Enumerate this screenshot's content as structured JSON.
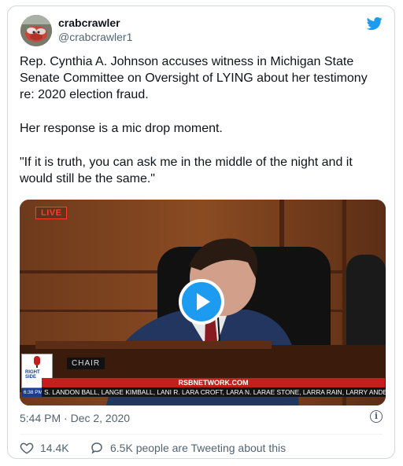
{
  "user": {
    "display_name": "crabcrawler",
    "handle": "@crabcrawler1",
    "avatar_icon": "avatar-image"
  },
  "tweet": {
    "paragraphs": [
      "Rep. Cynthia A. Johnson accuses witness in Michigan State Senate Committee on Oversight of LYING about her testimony re: 2020 election fraud.",
      "Her response is a mic drop moment.",
      "\"If it is truth, you can ask me in the middle of the night and it would still be the same.\""
    ],
    "timestamp": "5:44 PM · Dec 2, 2020"
  },
  "video": {
    "live_badge": "LIVE",
    "chair_sign": "CHAIR",
    "network_url": "RSBNETWORK.COM",
    "ticker_names": "S. LANDON BALL, LANGE KIMBALL, LANI R. LARA CROFT, LARA N. LARAE STONE, LARRA RAIN, LARRY ANDERSON, LARR",
    "logo_text_1": "RIGHT",
    "logo_text_2": "SIDE",
    "time_label": "6:38 PM ET",
    "play_icon": "play-icon"
  },
  "engagement": {
    "likes": "14.4K",
    "tweeting_text": "6.5K people are Tweeting about this"
  },
  "colors": {
    "brand_blue": "#1d9bf0",
    "muted_text": "#536471",
    "live_red": "#ff3b30",
    "ticker_red": "#c41e1e"
  }
}
